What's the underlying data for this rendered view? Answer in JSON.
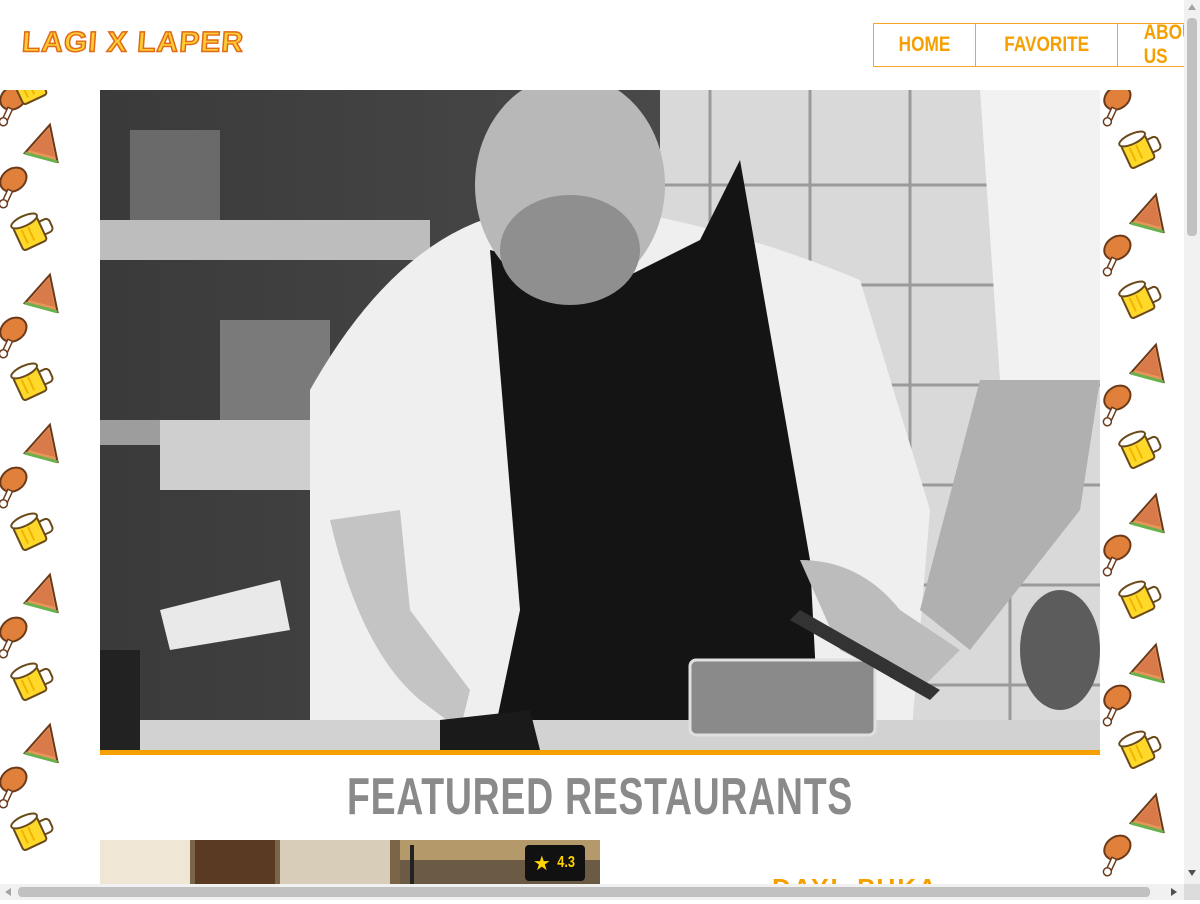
{
  "header": {
    "logo_text": "LAGI X LAPER",
    "nav": [
      "HOME",
      "FAVORITE",
      "ABOUT US"
    ]
  },
  "hero": {
    "image": "chef-plating-photo-grayscale"
  },
  "featured": {
    "title": "FEATURED RESTAURANTS",
    "cards": [
      {
        "rating": "4.3",
        "name_partial": "DAYL PUKA"
      }
    ]
  },
  "colors": {
    "accent": "#f5a000",
    "logo_fill": "#ffcc33",
    "logo_stroke": "#e06a17",
    "title_gray": "#8a8a8a"
  },
  "icons": [
    "star-icon",
    "chicken-leg-icon",
    "beer-mug-icon",
    "sandwich-icon"
  ]
}
